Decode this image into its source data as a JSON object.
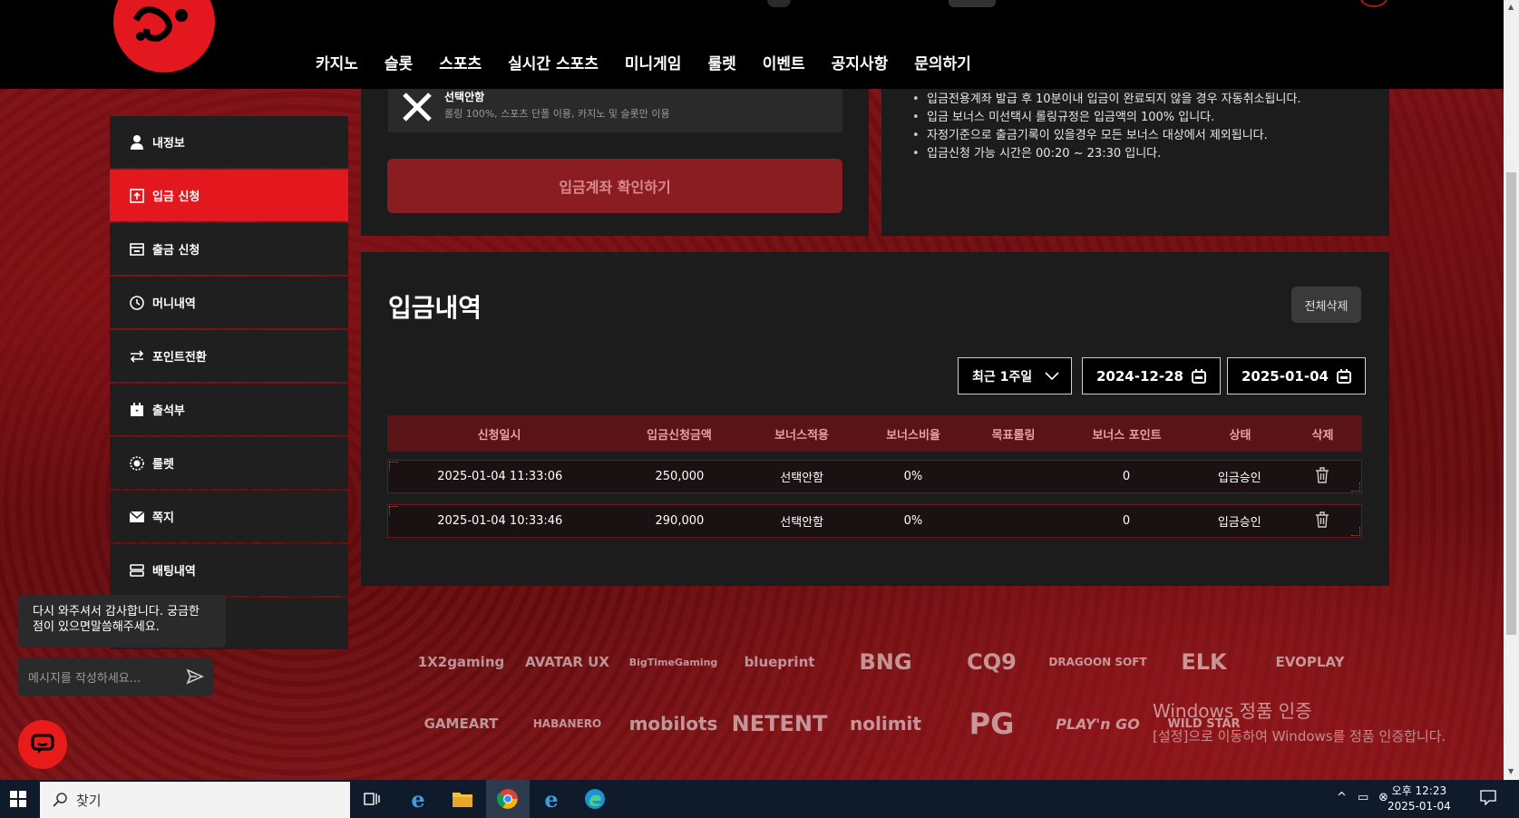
{
  "nav": [
    "카지노",
    "슬롯",
    "스포츠",
    "실시간 스포츠",
    "미니게임",
    "룰렛",
    "이벤트",
    "공지사항",
    "문의하기"
  ],
  "sidebar": [
    {
      "label": "내정보",
      "icon": "user-icon",
      "active": false
    },
    {
      "label": "입금 신청",
      "icon": "deposit-icon",
      "active": true
    },
    {
      "label": "출금 신청",
      "icon": "withdraw-icon",
      "active": false
    },
    {
      "label": "머니내역",
      "icon": "clock-icon",
      "active": false
    },
    {
      "label": "포인트전환",
      "icon": "exchange-icon",
      "active": false
    },
    {
      "label": "출석부",
      "icon": "calendar-icon",
      "active": false
    },
    {
      "label": "룰렛",
      "icon": "roulette-icon",
      "active": false
    },
    {
      "label": "쪽지",
      "icon": "mail-icon",
      "active": false
    },
    {
      "label": "배팅내역",
      "icon": "list-icon",
      "active": false
    },
    {
      "label": "",
      "icon": "",
      "active": false
    }
  ],
  "bonus": {
    "title": "선택안함",
    "desc": "롤링 100%, 스포츠 단폴 이용, 카지노 및 슬롯만 이용"
  },
  "confirm_button": "입금계좌 확인하기",
  "notes": [
    "입금전용계좌 발급 후 10분이내 입금이 완료되지 않을 경우 자동취소됩니다.",
    "입금 보너스 미선택시 롤링규정은 입금액의 100% 입니다.",
    "자정기준으로 출금기록이 있을경우 모든 보너스 대상에서 제외됩니다.",
    "입금신청 가능 시간은 00:20 ~ 23:30 입니다."
  ],
  "history": {
    "title": "입금내역",
    "delete_all": "전체삭제",
    "period": "최근 1주일",
    "date_from": "2024-12-28",
    "date_to": "2025-01-04",
    "columns": [
      "신청일시",
      "입금신청금액",
      "보너스적용",
      "보너스비율",
      "목표롤링",
      "보너스 포인트",
      "상태",
      "삭제"
    ],
    "rows": [
      {
        "datetime": "2025-01-04 11:33:06",
        "amount": "250,000",
        "bonus": "선택안함",
        "ratio": "0%",
        "target": "",
        "points": "0",
        "status": "입금승인"
      },
      {
        "datetime": "2025-01-04 10:33:46",
        "amount": "290,000",
        "bonus": "선택안함",
        "ratio": "0%",
        "target": "",
        "points": "0",
        "status": "입금승인"
      }
    ]
  },
  "providers_row1": [
    "1X2gaming",
    "AVATAR UX",
    "BigTimeGaming",
    "blueprint",
    "BNG",
    "CQ9",
    "DRAGOON SOFT",
    "ELK",
    "EVOPLAY"
  ],
  "providers_row2": [
    "GAMEART",
    "HABANERO",
    "mobilots",
    "NETENT",
    "nolimit",
    "PG",
    "PLAY'n GO",
    "WILD STAR"
  ],
  "windows_activation": {
    "title": "Windows 정품 인증",
    "subtitle": "[설정]으로 이동하여 Windows를 정품 인증합니다."
  },
  "chat": {
    "message": "다시 와주셔서 감사합니다. 궁금한 점이 있으면말씀해주세요.",
    "placeholder": "메시지를 작성하세요..."
  },
  "taskbar": {
    "search": "찾기",
    "time": "오후 12:23",
    "date": "2025-01-04"
  },
  "colors": {
    "accent": "#e3171e",
    "panel": "#1c1c1c",
    "table_header": "#5a1418"
  }
}
